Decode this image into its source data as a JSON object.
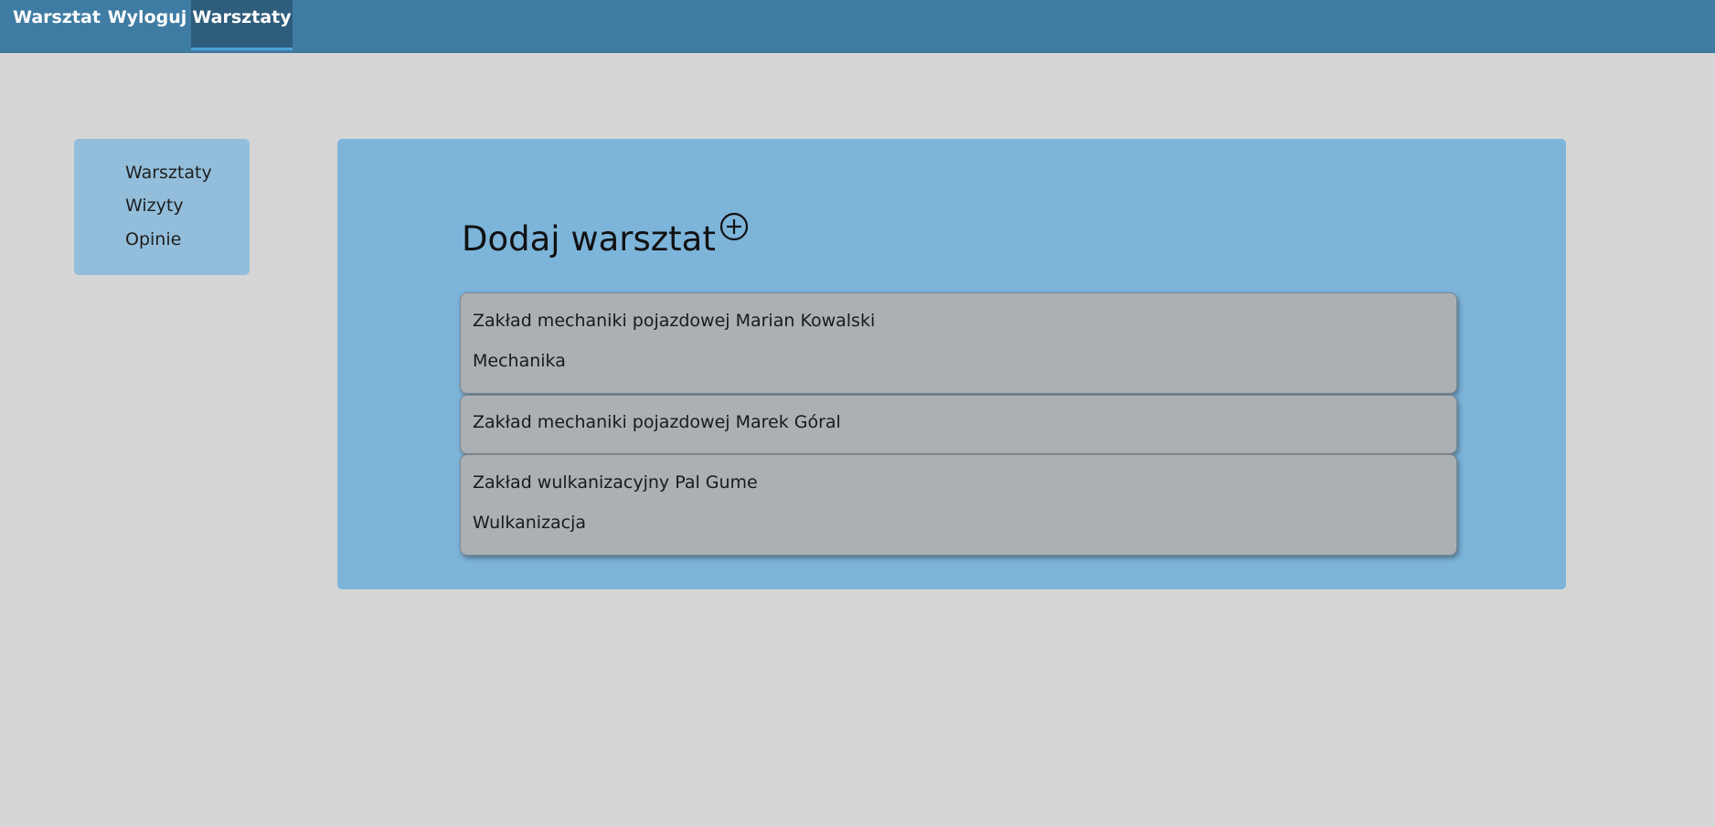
{
  "navbar": {
    "items": [
      {
        "label": "Warsztat",
        "active": false
      },
      {
        "label": "Wyloguj",
        "active": false
      },
      {
        "label": "Warsztaty",
        "active": true
      }
    ],
    "background_color": "#3f7ca3",
    "active_color": "#2f5d7c",
    "active_underline_color": "#4aa3d6"
  },
  "sidebar": {
    "items": [
      {
        "label": "Warsztaty"
      },
      {
        "label": "Wizyty"
      },
      {
        "label": "Opinie"
      }
    ]
  },
  "main": {
    "title": "Dodaj warsztat",
    "add_icon": "plus-circle-icon",
    "workshops": [
      {
        "name": "Zakład mechaniki pojazdowej Marian Kowalski",
        "type": "Mechanika"
      },
      {
        "name": "Zakład mechaniki pojazdowej Marek Góral",
        "type": ""
      },
      {
        "name": "Zakład wulkanizacyjny Pal Gume",
        "type": "Wulkanizacja"
      }
    ]
  },
  "colors": {
    "page_background": "#d6d6d6",
    "sidebar_background": "#93bedb",
    "panel_background": "#7db4da",
    "card_background": "#aab0b4"
  }
}
